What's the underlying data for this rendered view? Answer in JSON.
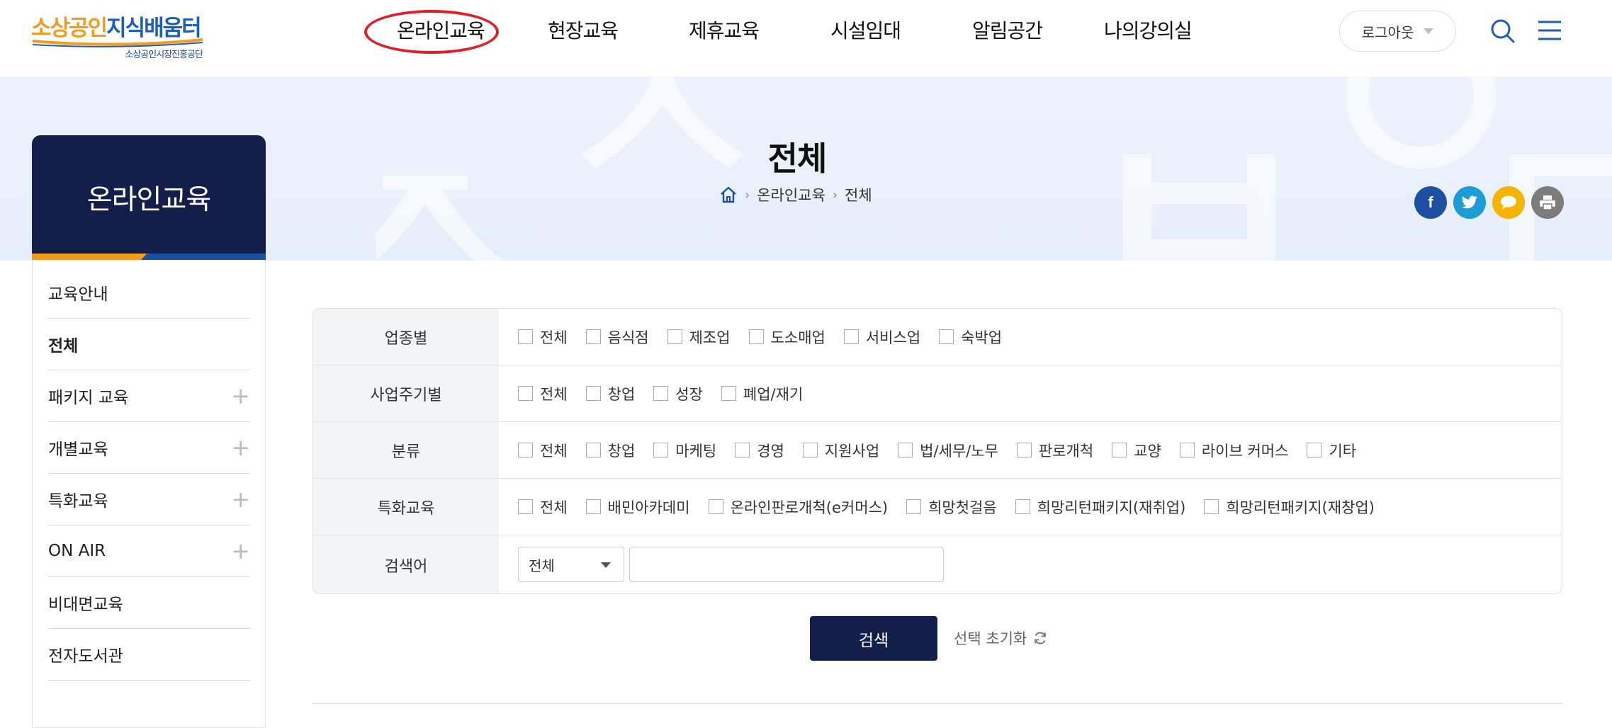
{
  "logo": {
    "main_orange": "소상공인",
    "main_blue": "지식배움터",
    "sub": "소상공인시장진흥공단"
  },
  "gnb": [
    {
      "label": "온라인교육"
    },
    {
      "label": "현장교육"
    },
    {
      "label": "제휴교육"
    },
    {
      "label": "시설임대"
    },
    {
      "label": "알림공간"
    },
    {
      "label": "나의강의실"
    }
  ],
  "header": {
    "logout_label": "로그아웃"
  },
  "banner": {
    "title": "전체",
    "breadcrumb": [
      "온라인교육",
      "전체"
    ]
  },
  "share_icons": [
    "facebook-icon",
    "twitter-icon",
    "kakaostory-icon",
    "print-icon"
  ],
  "colors": {
    "navy": "#141e4a",
    "orange": "#f39a1f",
    "blue": "#1d5fb7",
    "highlight_circle": "#e31d24",
    "facebook": "#1d4fa3",
    "twitter": "#1d9bd8",
    "kakao": "#f5b400",
    "print": "#7c7c7c"
  },
  "lnb": {
    "title": "온라인교육",
    "items": [
      {
        "label": "교육안내",
        "expandable": false
      },
      {
        "label": "전체",
        "expandable": false
      },
      {
        "label": "패키지 교육",
        "expandable": true
      },
      {
        "label": "개별교육",
        "expandable": true
      },
      {
        "label": "특화교육",
        "expandable": true
      },
      {
        "label": "ON AIR",
        "expandable": true
      },
      {
        "label": "비대면교육",
        "expandable": false
      },
      {
        "label": "전자도서관",
        "expandable": false
      }
    ]
  },
  "filters": [
    {
      "label": "업종별",
      "options": [
        "전체",
        "음식점",
        "제조업",
        "도소매업",
        "서비스업",
        "숙박업"
      ]
    },
    {
      "label": "사업주기별",
      "options": [
        "전체",
        "창업",
        "성장",
        "폐업/재기"
      ]
    },
    {
      "label": "분류",
      "options": [
        "전체",
        "창업",
        "마케팅",
        "경영",
        "지원사업",
        "법/세무/노무",
        "판로개척",
        "교양",
        "라이브 커머스",
        "기타"
      ]
    },
    {
      "label": "특화교육",
      "options": [
        "전체",
        "배민아카데미",
        "온라인판로개척(e커머스)",
        "희망첫걸음",
        "희망리턴패키지(재취업)",
        "희망리턴패키지(재창업)"
      ]
    }
  ],
  "keyword": {
    "label": "검색어",
    "select_value": "전체",
    "input_value": ""
  },
  "actions": {
    "search_label": "검색",
    "reset_label": "선택 초기화"
  }
}
